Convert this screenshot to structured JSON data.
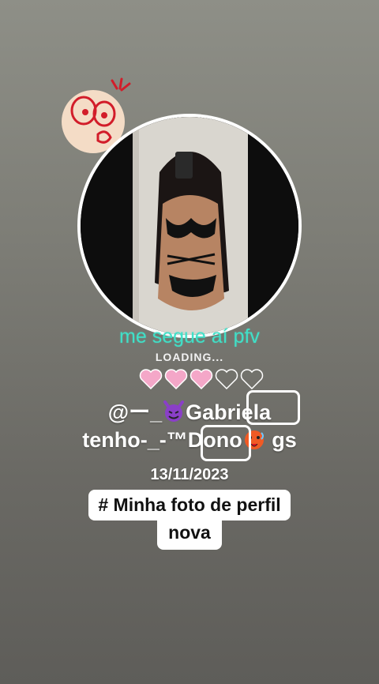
{
  "sticker": {
    "icon": "shocked-face-sticker-icon"
  },
  "profile": {
    "avatar_icon": "profile-photo-icon",
    "headline": "me segue aí pfv",
    "loading": "LOADING...",
    "hearts_filled": 3,
    "hearts_total": 5,
    "username_prefix": "@ー_",
    "username_name": "Gabriela",
    "bio_prefix": "tenho-_-™D",
    "bio_mid": "ono",
    "bio_suffix": " gs",
    "date": "13/11/2023"
  },
  "caption": {
    "line1": "# Minha foto de perfil",
    "line2": "nova"
  },
  "colors": {
    "accent_teal": "#40e0c8",
    "heart_pink": "#f4a7c8",
    "devil_purple": "#8a3fc7"
  }
}
